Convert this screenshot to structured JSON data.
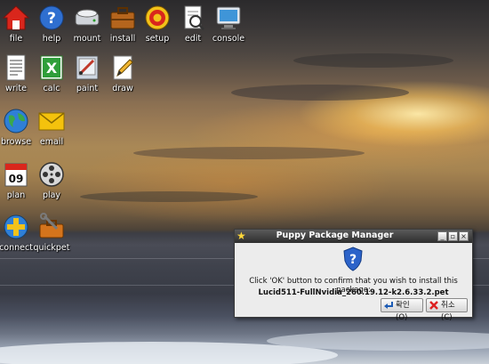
{
  "desktop": {
    "icons": [
      {
        "label": "file",
        "icon": "home-folder-icon"
      },
      {
        "label": "help",
        "icon": "help-icon"
      },
      {
        "label": "mount",
        "icon": "drive-icon"
      },
      {
        "label": "install",
        "icon": "briefcase-icon"
      },
      {
        "label": "setup",
        "icon": "setup-target-icon"
      },
      {
        "label": "edit",
        "icon": "edit-document-icon"
      },
      {
        "label": "console",
        "icon": "monitor-icon"
      },
      {
        "label": "write",
        "icon": "text-document-icon"
      },
      {
        "label": "calc",
        "icon": "spreadsheet-icon"
      },
      {
        "label": "paint",
        "icon": "paint-icon"
      },
      {
        "label": "draw",
        "icon": "draw-pencil-icon"
      },
      {
        "label": "browse",
        "icon": "globe-icon"
      },
      {
        "label": "email",
        "icon": "envelope-icon"
      },
      {
        "label": "plan",
        "icon": "calendar-icon"
      },
      {
        "label": "play",
        "icon": "film-reel-icon"
      },
      {
        "label": "connect",
        "icon": "network-icon"
      },
      {
        "label": "quickpet",
        "icon": "toolbox-icon"
      }
    ],
    "calendar_day": "09"
  },
  "dialog": {
    "title": "Puppy Package Manager",
    "message": "Click 'OK' button to confirm that you wish to install this package:",
    "package_name": "Lucid511-FullNvidia_260.19.12-k2.6.33.2.pet",
    "ok_label": "확인(O)",
    "cancel_label": "취소(C)",
    "titlebar_buttons": {
      "minimize": "_",
      "maximize": "▫",
      "close": "×"
    }
  }
}
